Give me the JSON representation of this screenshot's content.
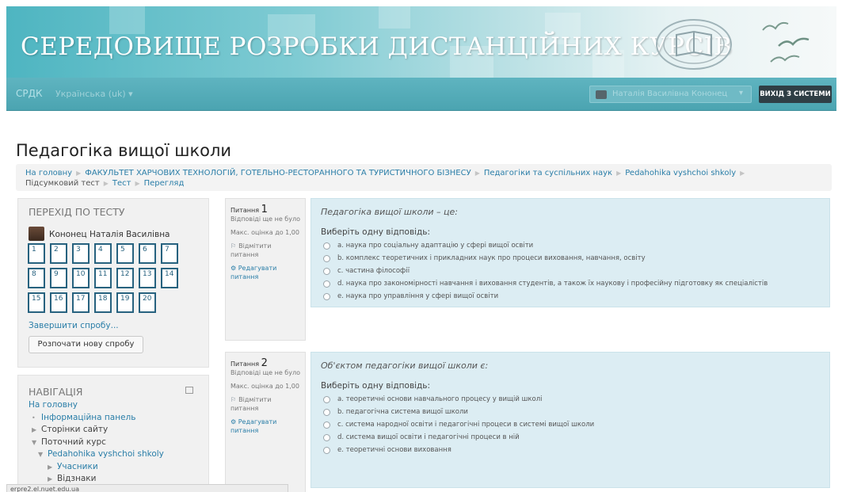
{
  "banner": {
    "title": "СЕРЕДОВИЩЕ РОЗРОБКИ ДИСТАНЦІЙНИХ КУРСІВ"
  },
  "navbar": {
    "brand": "СРДК",
    "language": "Українська (uk) ▾",
    "user_name": "Наталія Василівна Кононец",
    "logout": "ВИХІД З СИСТЕМИ"
  },
  "page": {
    "title": "Педагогіка вищої школи"
  },
  "breadcrumb": [
    {
      "label": "На головну",
      "link": true
    },
    {
      "label": "ФАКУЛЬТЕТ ХАРЧОВИХ ТЕХНОЛОГІЙ, ГОТЕЛЬНО-РЕСТОРАННОГО ТА ТУРИСТИЧНОГО БІЗНЕСУ",
      "link": true
    },
    {
      "label": "Педагогіки та суспільних наук",
      "link": true
    },
    {
      "label": "Pedahohika vyshchoi shkoly",
      "link": true
    },
    {
      "label": "Підсумковий тест",
      "link": false
    },
    {
      "label": "Тест",
      "link": true
    },
    {
      "label": "Перегляд",
      "link": true
    }
  ],
  "quiz_nav": {
    "title": "ПЕРЕХІД ПО ТЕСТУ",
    "user": "Кононец Наталія Василівна",
    "questions": [
      "1",
      "2",
      "3",
      "4",
      "5",
      "6",
      "7",
      "8",
      "9",
      "10",
      "11",
      "12",
      "13",
      "14",
      "15",
      "16",
      "17",
      "18",
      "19",
      "20"
    ],
    "finish": "Завершити спробу...",
    "new_attempt": "Розпочати нову спробу"
  },
  "navigation": {
    "title": "НАВІГАЦІЯ",
    "items": [
      {
        "label": "На головну",
        "marker": "",
        "link": true
      },
      {
        "label": "Інформаційна панель",
        "marker": "•",
        "link": true
      },
      {
        "label": "Сторінки сайту",
        "marker": "▶",
        "link": false
      },
      {
        "label": "Поточний курс",
        "marker": "▼",
        "link": false
      },
      {
        "label": "Pedahohika vyshchoi shkoly",
        "marker": "▼",
        "link": true
      },
      {
        "label": "Учасники",
        "marker": "▶",
        "link": true
      },
      {
        "label": "Відзнаки",
        "marker": "▶",
        "link": false
      }
    ]
  },
  "status_bar": "erpre2.el.nuet.edu.ua",
  "questions": [
    {
      "label": "Питання",
      "number": "1",
      "status": "Відповіді ще не було",
      "max_grade": "Макс. оцінка до 1,00",
      "flag": "Відмітити питання",
      "edit": "Редагувати питання",
      "text": "Педагогіка вищої школи – це:",
      "prompt": "Виберіть одну відповідь:",
      "answers": [
        "a. наука про соціальну адаптацію у сфері вищої освіти",
        "b. комплекс теоретичних і прикладних наук про процеси виховання, навчання, освіту",
        "c. частина філософії",
        "d. наука про закономірності навчання і виховання студентів, а також їх наукову і професійну підготовку як спеціалістів",
        "e. наука про управління у сфері вищої освіти"
      ]
    },
    {
      "label": "Питання",
      "number": "2",
      "status": "Відповіді ще не було",
      "max_grade": "Макс. оцінка до 1,00",
      "flag": "Відмітити питання",
      "edit": "Редагувати питання",
      "text": "Об'єктом педагогіки вищої школи є:",
      "prompt": "Виберіть одну відповідь:",
      "answers": [
        "a. теоретичні основи навчального процесу у вищій школі",
        "b. педагогічна система вищої школи",
        "c. система народної освіти і педагогічні процеси в системі вищої школи",
        "d. система вищої освіти і педагогічні процеси в ній",
        "e. теоретичні основи виховання"
      ]
    }
  ]
}
